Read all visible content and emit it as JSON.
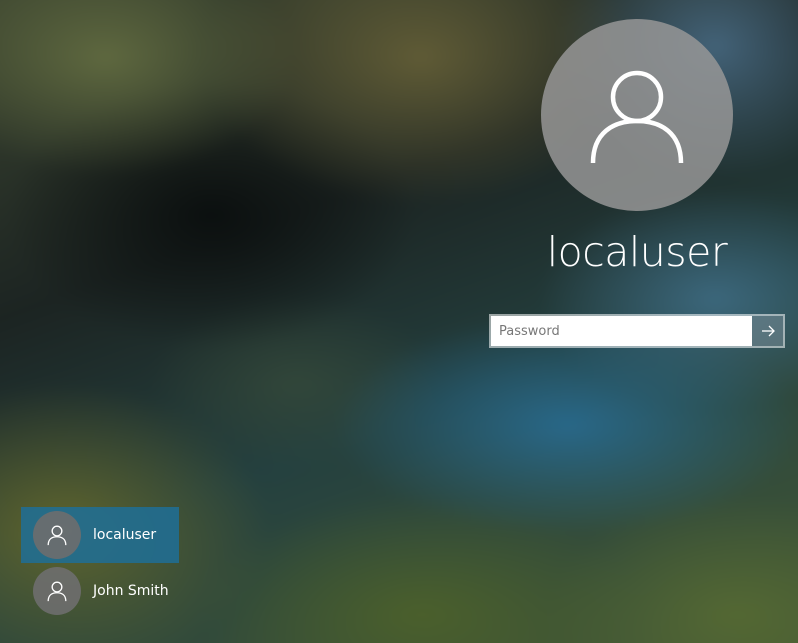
{
  "login": {
    "selected_user": "localuser",
    "password_placeholder": "Password",
    "password_value": ""
  },
  "users": [
    {
      "name": "localuser",
      "selected": true
    },
    {
      "name": "John Smith",
      "selected": false
    }
  ],
  "icons": {
    "large_avatar": "user-icon",
    "submit": "arrow-right-icon",
    "small_avatar": "user-icon"
  },
  "colors": {
    "selected_user_bg": "#1e6e96",
    "text": "#ffffff"
  }
}
